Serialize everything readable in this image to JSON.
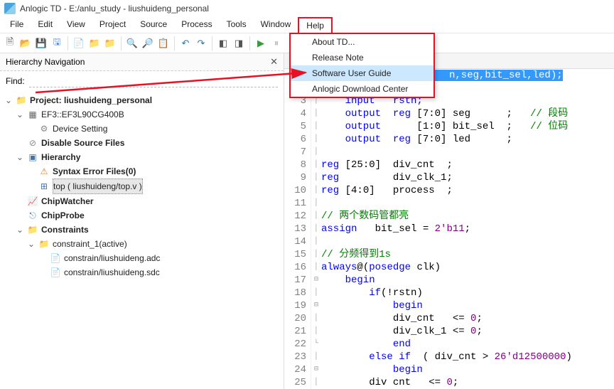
{
  "title": "Anlogic TD - E:/anlu_study - liushuideng_personal",
  "menu": {
    "file": "File",
    "edit": "Edit",
    "view": "View",
    "project": "Project",
    "source": "Source",
    "process": "Process",
    "tools": "Tools",
    "window": "Window",
    "help": "Help"
  },
  "help_menu": {
    "about": "About TD...",
    "release": "Release Note",
    "guide": "Software User Guide",
    "download": "Anlogic Download Center"
  },
  "panel": {
    "title": "Hierarchy Navigation",
    "find_label": "Find:"
  },
  "tree": {
    "project": "Project: liushuideng_personal",
    "device": "EF3::EF3L90CG400B",
    "devset": "Device Setting",
    "disable": "Disable Source Files",
    "hierarchy": "Hierarchy",
    "syntax": "Syntax Error Files(0)",
    "top": "top ( liushuideng/top.v )",
    "chipwatcher": "ChipWatcher",
    "chipprobe": "ChipProbe",
    "constraints": "Constraints",
    "constraint1": "constraint_1(active)",
    "adc": "constrain/liushuideng.adc",
    "sdc": "constrain/liushuideng.sdc"
  },
  "code": {
    "line1_sig": "n,seg,bit_sel,led);",
    "l3": "    input   rstn;",
    "l4a": "    output  reg ",
    "l4b": "[7:0]",
    "l4c": " seg      ;   ",
    "l4d": "// 段码",
    "l5a": "    output      ",
    "l5b": "[1:0]",
    "l5c": " bit_sel  ;   ",
    "l5d": "// 位码",
    "l6a": "    output  reg ",
    "l6b": "[7:0]",
    "l6c": " led      ;",
    "l8a": "reg ",
    "l8b": "[25:0]",
    "l8c": "  div_cnt  ;",
    "l9": "reg         div_clk_1;",
    "l10a": "reg ",
    "l10b": "[4:0]",
    "l10c": "   process  ;",
    "l12": "// 两个数码管都亮",
    "l13a": "assign   bit_sel = ",
    "l13b": "2'b11",
    "l15": "// 分频得到1s",
    "l16": "always@(posedge clk)",
    "l17": "    begin",
    "l18": "        if(!rstn)",
    "l19": "            begin",
    "l20a": "            div_cnt   <= ",
    "l20b": "0",
    "l21a": "            div_clk_1 <= ",
    "l21b": "0",
    "l22": "            end",
    "l23a": "        else if  ( div_cnt > ",
    "l23b": "26'd12500000",
    "l23c": ")",
    "l24": "            begin",
    "l25a": "        div cnt   <= ",
    "l25b": "0"
  }
}
